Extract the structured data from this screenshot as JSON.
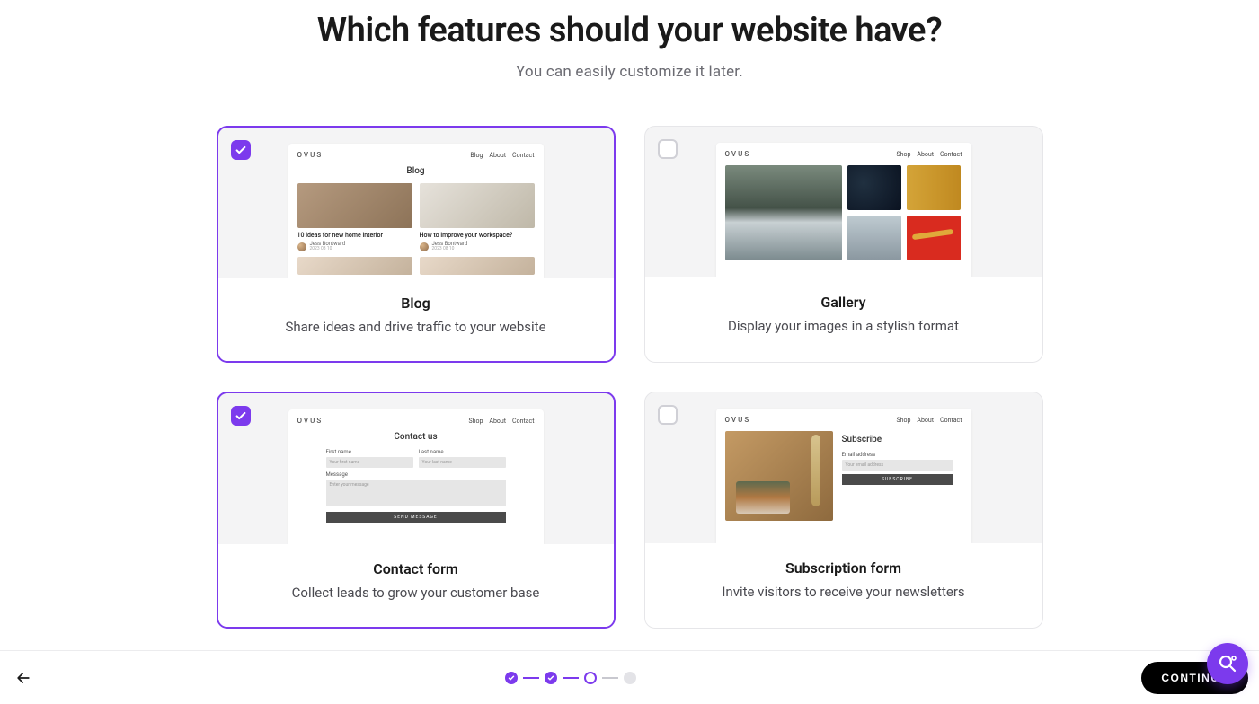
{
  "heading": "Which features should your website have?",
  "subheading": "You can easily customize it later.",
  "features": [
    {
      "id": "blog",
      "title": "Blog",
      "desc": "Share ideas and drive traffic to your website",
      "selected": true,
      "preview": {
        "brand": "OVUS",
        "nav": [
          "Blog",
          "About",
          "Contact"
        ],
        "title": "Blog",
        "items": [
          {
            "title": "10 ideas for new home interior",
            "author": "Jess Bontward",
            "date": "2023 08 10"
          },
          {
            "title": "How to improve your workspace?",
            "author": "Jess Bontward",
            "date": "2023 08 10"
          }
        ]
      }
    },
    {
      "id": "gallery",
      "title": "Gallery",
      "desc": "Display your images in a stylish format",
      "selected": false,
      "preview": {
        "brand": "OVUS",
        "nav": [
          "Shop",
          "About",
          "Contact"
        ]
      }
    },
    {
      "id": "contact",
      "title": "Contact form",
      "desc": "Collect leads to grow your customer base",
      "selected": true,
      "preview": {
        "brand": "OVUS",
        "nav": [
          "Shop",
          "About",
          "Contact"
        ],
        "title": "Contact us",
        "fields": {
          "first_label": "First name",
          "first_ph": "Your first name",
          "last_label": "Last name",
          "last_ph": "Your last name",
          "msg_label": "Message",
          "msg_ph": "Enter your message",
          "button": "SEND MESSAGE"
        }
      }
    },
    {
      "id": "subscription",
      "title": "Subscription form",
      "desc": "Invite visitors to receive your newsletters",
      "selected": false,
      "preview": {
        "brand": "OVUS",
        "nav": [
          "Shop",
          "About",
          "Contact"
        ],
        "title": "Subscribe",
        "fields": {
          "email_label": "Email address",
          "email_ph": "Your email address",
          "button": "SUBSCRIBE"
        }
      }
    }
  ],
  "footer": {
    "continue": "CONTINUE",
    "steps": [
      {
        "state": "done"
      },
      {
        "state": "done"
      },
      {
        "state": "current"
      },
      {
        "state": "todo"
      }
    ]
  }
}
